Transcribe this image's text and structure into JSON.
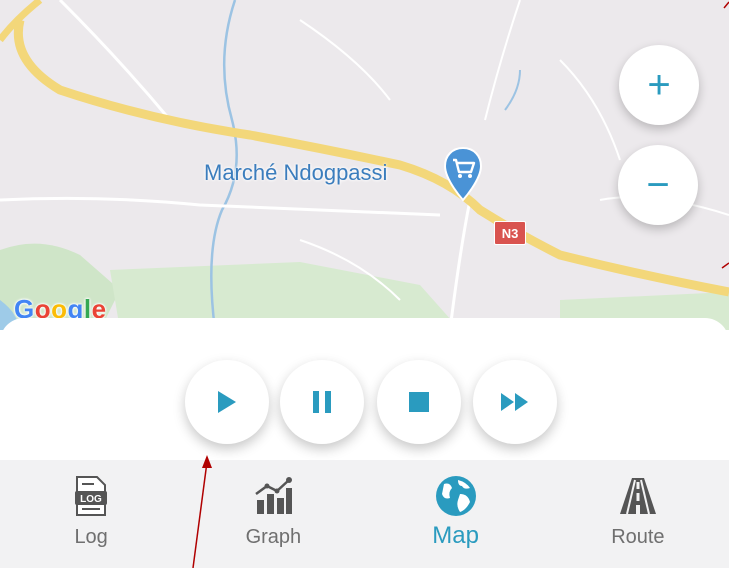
{
  "map": {
    "place_label": "Marché Ndogpassi",
    "road_shield": "N3",
    "provider_logo": "Google",
    "zoom_in_symbol": "+",
    "zoom_out_symbol": "−",
    "place_icon": "shopping-cart-pin-icon"
  },
  "controls": [
    {
      "name": "play",
      "icon": "play-icon"
    },
    {
      "name": "pause",
      "icon": "pause-icon"
    },
    {
      "name": "stop",
      "icon": "stop-icon"
    },
    {
      "name": "fast-forward",
      "icon": "fast-forward-icon"
    }
  ],
  "nav": {
    "items": [
      {
        "label": "Log",
        "icon": "log-file-icon",
        "active": false
      },
      {
        "label": "Graph",
        "icon": "graph-icon",
        "active": false
      },
      {
        "label": "Map",
        "icon": "globe-icon",
        "active": true
      },
      {
        "label": "Route",
        "icon": "road-icon",
        "active": false
      }
    ]
  },
  "colors": {
    "accent": "#2a9bbf",
    "map_background": "#ece9ec",
    "major_road": "#f3d77a",
    "road_shield": "#d9534f",
    "annotation_arrow": "#b00000"
  }
}
